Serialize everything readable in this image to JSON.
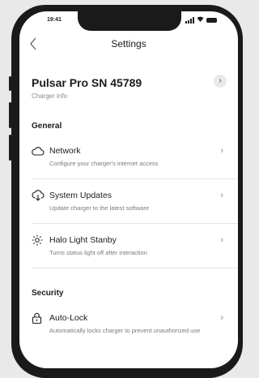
{
  "status_bar": {
    "time": "19:41"
  },
  "navbar": {
    "back_icon": "chevron-left-icon",
    "title": "Settings"
  },
  "device": {
    "name": "Pulsar Pro SN 45789",
    "subtitle": "Charger info",
    "arrow_icon": "chevron-right-icon"
  },
  "sections": {
    "general": {
      "title": "General",
      "items": [
        {
          "icon": "cloud-icon",
          "title": "Network",
          "description": "Configure your charger's internet access"
        },
        {
          "icon": "cloud-download-icon",
          "title": "System Updates",
          "description": "Update charger to the latest software"
        },
        {
          "icon": "sun-icon",
          "title": "Halo Light Stanby",
          "description": "Turns status light off after interaction"
        }
      ]
    },
    "security": {
      "title": "Security",
      "items": [
        {
          "icon": "lock-icon",
          "title": "Auto-Lock",
          "description": "Automatically locks charger to prevent unauthorized use"
        }
      ]
    }
  },
  "chevron_glyph": "›"
}
